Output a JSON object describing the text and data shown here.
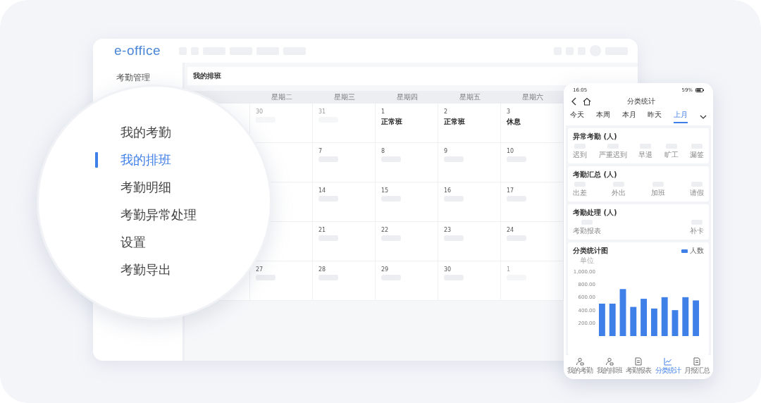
{
  "app": {
    "logo": "e-office"
  },
  "sidebar": {
    "title": "考勤管理"
  },
  "magnifier": {
    "items": [
      {
        "label": "我的考勤",
        "selected": false
      },
      {
        "label": "我的排班",
        "selected": true
      },
      {
        "label": "考勤明细",
        "selected": false
      },
      {
        "label": "考勤异常处理",
        "selected": false
      },
      {
        "label": "设置",
        "selected": false
      },
      {
        "label": "考勤导出",
        "selected": false
      }
    ]
  },
  "page": {
    "title": "我的排班"
  },
  "calendar": {
    "weekdays": [
      "星期二",
      "星期三",
      "星期四",
      "星期五",
      "星期六"
    ],
    "rows": [
      [
        {
          "date": "30",
          "muted": true
        },
        {
          "date": "31",
          "muted": true
        },
        {
          "date": "1",
          "muted": false,
          "shift": "正常班"
        },
        {
          "date": "2",
          "muted": false,
          "shift": "正常班"
        },
        {
          "date": "3",
          "muted": false,
          "shift": "休息"
        }
      ],
      [
        {
          "date": "7",
          "muted": false
        },
        {
          "date": "8",
          "muted": false
        },
        {
          "date": "9",
          "muted": false
        },
        {
          "date": "10",
          "muted": false
        }
      ],
      [
        {
          "date": "14",
          "muted": false
        },
        {
          "date": "15",
          "muted": false
        },
        {
          "date": "16",
          "muted": false
        },
        {
          "date": "17",
          "muted": false
        }
      ],
      [
        {
          "date": "21",
          "muted": false
        },
        {
          "date": "22",
          "muted": false
        },
        {
          "date": "23",
          "muted": false
        },
        {
          "date": "24",
          "muted": false
        }
      ],
      [
        {
          "date": "27",
          "muted": false
        },
        {
          "date": "28",
          "muted": false
        },
        {
          "date": "29",
          "muted": false
        },
        {
          "date": "30",
          "muted": false
        },
        {
          "date": "1",
          "muted": true
        }
      ]
    ]
  },
  "phone": {
    "status": {
      "time": "16:05",
      "battery": "59%"
    },
    "title": "分类统计",
    "tabs": [
      {
        "label": "今天",
        "selected": false
      },
      {
        "label": "本周",
        "selected": false
      },
      {
        "label": "本月",
        "selected": false
      },
      {
        "label": "昨天",
        "selected": false
      },
      {
        "label": "上月",
        "selected": true
      }
    ],
    "sections": [
      {
        "title": "异常考勤 (人)",
        "items": [
          "迟到",
          "严重迟到",
          "早退",
          "旷工",
          "漏签"
        ]
      },
      {
        "title": "考勤汇总 (人)",
        "items": [
          "出差",
          "外出",
          "加班",
          "请假"
        ]
      },
      {
        "title": "考勤处理 (人)",
        "items": [
          "考勤报表",
          "补卡"
        ]
      }
    ],
    "chart_title": "分类统计图",
    "chart_data": {
      "type": "bar",
      "ylabel": "单位",
      "series": [
        {
          "name": "人数",
          "color": "#3f7fe8",
          "values": [
            500,
            500,
            725,
            450,
            575,
            425,
            600,
            400,
            600,
            550
          ]
        }
      ],
      "ylim": [
        0,
        1000
      ],
      "yticks": [
        {
          "value": 200,
          "label": "200.00"
        },
        {
          "value": 400,
          "label": "400.00"
        },
        {
          "value": 600,
          "label": "600.00"
        },
        {
          "value": 800,
          "label": "800.00"
        },
        {
          "value": 1000,
          "label": "1,000.00"
        }
      ]
    },
    "nav": [
      {
        "label": "我的考勤",
        "selected": false
      },
      {
        "label": "我的排班",
        "selected": false
      },
      {
        "label": "考勤报表",
        "selected": false
      },
      {
        "label": "分类统计",
        "selected": true
      },
      {
        "label": "月报汇总",
        "selected": false
      }
    ]
  }
}
